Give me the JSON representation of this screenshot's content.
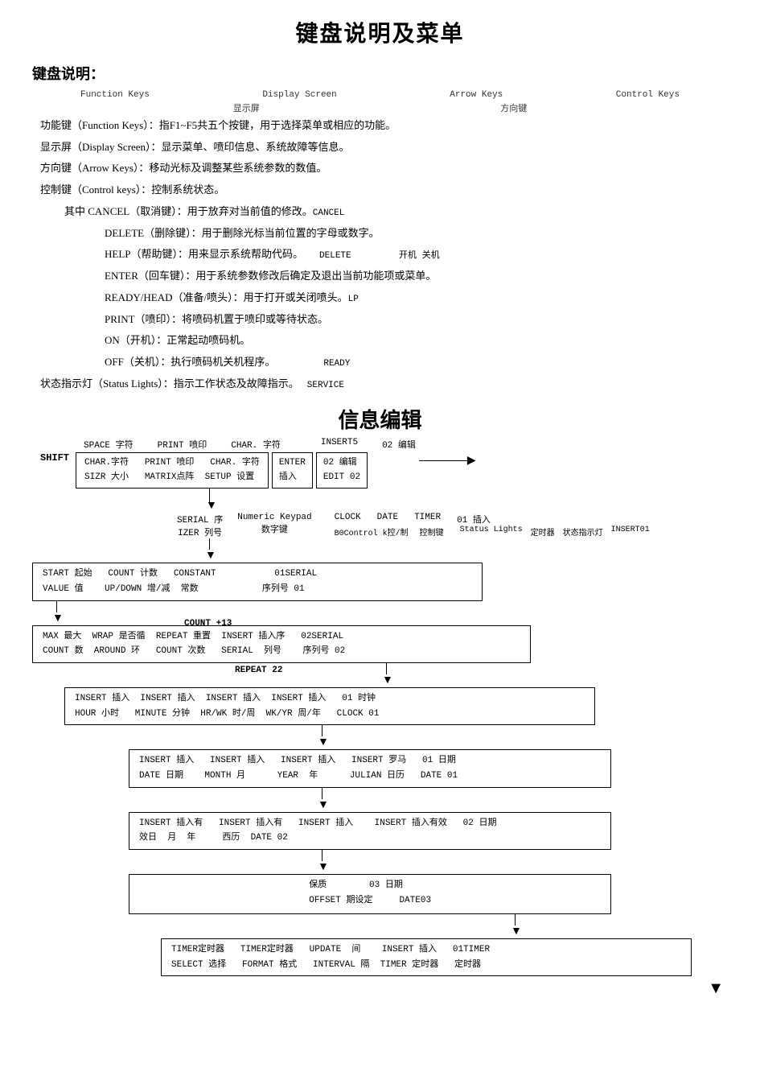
{
  "page": {
    "title": "键盘说明及菜单",
    "section1_title": "键盘说明：",
    "section2_title": "信息编辑"
  },
  "keyboard_labels": {
    "function_keys": "Function Keys",
    "display_screen": "Display Screen",
    "arrow_keys": "Arrow Keys",
    "control_keys": "Control Keys",
    "display_screen_cn": "显示屏",
    "arrow_keys_cn": "方向键"
  },
  "descriptions": [
    {
      "indent": 0,
      "text": "功能键（Function Keys）：指F1~F5共五个按键，用于选择菜单或相应的功能。"
    },
    {
      "indent": 0,
      "text": "显示屏（Display Screen）：显示菜单、喷印信息、系统故障等信息。"
    },
    {
      "indent": 0,
      "text": "方向键（Arrow Keys）：移动光标及调整某些系统参数的数值。"
    },
    {
      "indent": 0,
      "text": "控制键（Control keys）：控制系统状态。"
    },
    {
      "indent": 1,
      "text": "其中 CANCEL（取消键）：用于放弃对当前值的修改。",
      "inline": "CANCEL"
    },
    {
      "indent": 2,
      "text": "DELETE（删除键）：用于删除光标当前位置的字母或数字。"
    },
    {
      "indent": 2,
      "text": "HELP（帮助键）：用来显示系统帮助代码。",
      "inline2": "DELETE   开机 关机"
    },
    {
      "indent": 2,
      "text": "ENTER（回车键）：用于系统参数修改后确定及退出当前功能项或菜单。"
    },
    {
      "indent": 2,
      "text": "READY/HEAD（准备/喷头）：用于打开或关闭喷头。",
      "inline3": "LP"
    },
    {
      "indent": 2,
      "text": "PRINT（喷印）：将喷码机置于喷印或等待状态。"
    },
    {
      "indent": 2,
      "text": "ON（开机）：正常起动喷码机。"
    },
    {
      "indent": 2,
      "text": "OFF（关机）：执行喷码机关机程序。",
      "inline4": "READY"
    },
    {
      "indent": 0,
      "text": "状态指示灯（Status Lights）：指示工作状态及故障指示。",
      "inline5": "SERVICE"
    }
  ],
  "diagram": {
    "top_labels": {
      "shift": "SHIFT",
      "space_char": "SPACE 字符",
      "print_shift": "PRINT 喷印",
      "char_cn": "CHAR. 字符",
      "inserts": "INSERT5",
      "edit02": "02 编辑"
    },
    "row1_box1": {
      "line1": "CHAR.字符   PRINT 喷印   CHAR. 字符",
      "line2": "SIZR 大小   MATRIX点阵   SETUP 设置"
    },
    "row1_box2": {
      "line1": "ENTER",
      "line2": "插入"
    },
    "row1_box3": {
      "line1": "02 编辑",
      "line2": "EDIT 02"
    },
    "row2_labels": {
      "serial": "SERIAL 序",
      "numeric_keypad": "Numeric Keypad",
      "clock": "CLOCK",
      "date": "DATE",
      "timer": "TIMER",
      "insert01": "01 插入",
      "izer": "IZER 列号",
      "numeric_cn": "数字键",
      "bcontrol": "B0Control k控/制",
      "control_cn": "控制键",
      "status_lights": "Status Lights",
      "timer01": "定时器",
      "status_cn": "状态指示灯",
      "insert01_2": "INSERT01"
    },
    "row3_box": {
      "line1": "START 起始   COUNT 计数   CONSTANT            01SERIAL",
      "line2": "VALUE 值    UP/DOWN 增/减   常数               序列号 01"
    },
    "row4_box": {
      "line1": "MAX 最大  WRAP 是否循  REPEAT 重置  INSERT 插入序   02SERIAL",
      "line2": "COUNT 数  AROUND 环   COUNT 次数   SERIAL  列号    序列号 02"
    },
    "row5_box": {
      "line1": "INSERT 插入   INSERT 插入   INSERT 插入   INSERT 插入   01 时钟",
      "line2": "HOUR 小时     MINUTE 分钟   HR/WK 时/周   WK/YR 周/年   CLOCK 01"
    },
    "row6_box": {
      "line1": "INSERT 插入   INSERT 插入   INSERT 插入   INSERT 罗马   01 日期",
      "line2": "DATE 日期     MONTH 月      YEAR  年      JULIAN 日历   DATE 01"
    },
    "row7_box": {
      "line1": "INSERT 插入有   INSERT 插入有   INSERT 插入     INSERT 插入有效   02 日期",
      "line2": "效日  月  年    西历  DATE 02"
    },
    "row8_box": {
      "line1": "                      保质         03 日期",
      "line2": "                      OFFSET 期设定      DATE03"
    },
    "row9_box": {
      "line1": "TIMER定时器   TIMER定时器   UPDATE  间    INSERT 插入   01TIMER",
      "line2": "SELECT 选择   FORMAT 格式   INTERVAL 隔   TIMER 定时器   定时器"
    },
    "repeat22": "REPEAT 22",
    "count13": "COUNT +13"
  }
}
